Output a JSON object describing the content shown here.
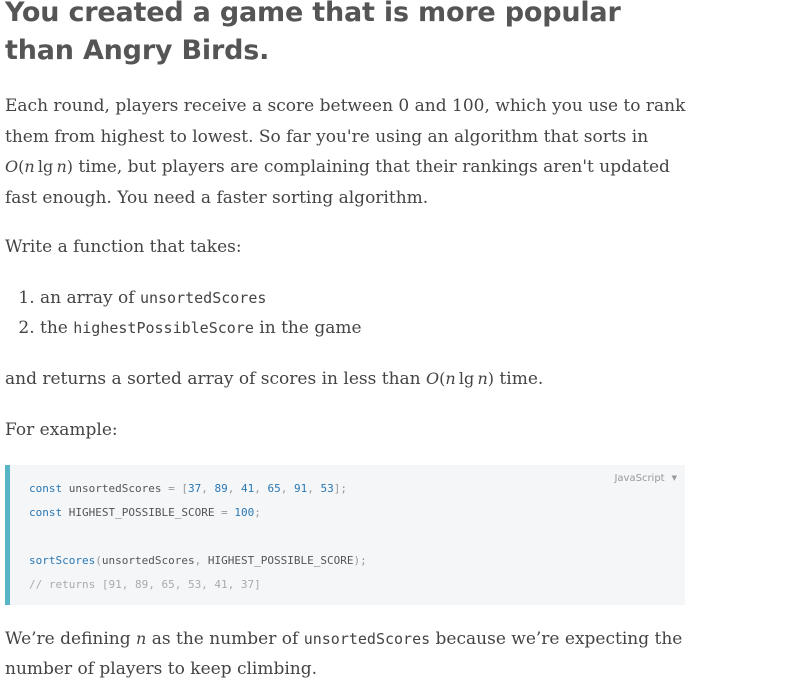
{
  "heading": "You created a game that is more popular than Angry Birds.",
  "intro": {
    "text_before": "Each round, players receive a score between 0 and 100, which you use to rank them from highest to lowest. So far you're using an algorithm that sorts in ",
    "math_O": "O",
    "math_n1": "n",
    "math_lg": "lg",
    "math_n2": "n",
    "text_after": " time, but players are complaining that their rankings aren't updated fast enough. You need a faster sorting algorithm."
  },
  "write_function": "Write a function that takes:",
  "list": [
    {
      "prefix": "an array of ",
      "code": "unsortedScores",
      "suffix": ""
    },
    {
      "prefix": "the ",
      "code": "highestPossibleScore",
      "suffix": " in the game"
    }
  ],
  "returns": {
    "text_before": "and returns a sorted array of scores in less than ",
    "math_O": "O",
    "math_n1": "n",
    "math_lg": "lg",
    "math_n2": "n",
    "text_after": " time."
  },
  "for_example": "For example:",
  "code_block": {
    "language": "JavaScript",
    "line1": {
      "kw": "const",
      "name": "unsortedScores",
      "op": "=",
      "open": "[",
      "values": [
        "37",
        "89",
        "41",
        "65",
        "91",
        "53"
      ],
      "close": "];"
    },
    "line2": {
      "kw": "const",
      "name": "HIGHEST_POSSIBLE_SCORE",
      "op": "=",
      "value": "100",
      "end": ";"
    },
    "line3": {
      "fn": "sortScores",
      "open": "(",
      "arg1": "unsortedScores",
      "comma": ",",
      "arg2": "HIGHEST_POSSIBLE_SCORE",
      "close": ");"
    },
    "comment": "// returns [91, 89, 65, 53, 41, 37]"
  },
  "closing": {
    "text_before": "We’re defining ",
    "math_n": "n",
    "text_middle": " as the number of ",
    "code": "unsortedScores",
    "text_after": " because we’re expecting the number of players to keep climbing."
  },
  "colors": {
    "accent_border": "#58b4c7",
    "code_background": "#f5f6f8",
    "keyword": "#2a78b4",
    "heading": "#555555",
    "body_text": "#444444"
  }
}
